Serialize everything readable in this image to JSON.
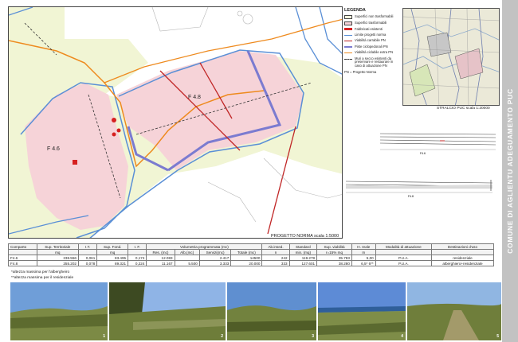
{
  "map": {
    "zone_labels": [
      "F 4.6",
      "F 4.8"
    ],
    "caption": "PROGETTO NORMA scala 1:5000"
  },
  "legend": {
    "title": "LEGENDA",
    "items": [
      {
        "label": "Superfici non trasformabili",
        "color": "#f4f6dc",
        "kind": "fill"
      },
      {
        "label": "Superfici trasformabili",
        "color": "#f6d3d8",
        "kind": "fill"
      },
      {
        "label": "Fabbricati esistenti",
        "color": "#d62020",
        "kind": "fill"
      },
      {
        "label": "Limite progetti norma",
        "color": "#5a8fd6",
        "kind": "line"
      },
      {
        "label": "Viabilità carrabile PN",
        "color": "#c02525",
        "kind": "line"
      },
      {
        "label": "Piste ciclopedonali PN",
        "color": "#7b7bd0",
        "kind": "line"
      },
      {
        "label": "Viabilità ciclabile extra PN",
        "color": "#ee8a1e",
        "kind": "line"
      },
      {
        "label": "Muri a secco esistenti da preservare e restaurare in caso di attuazione PN",
        "color": "#333333",
        "kind": "dash"
      },
      {
        "label": "PN = Progetto Norma",
        "color": "",
        "kind": "text"
      }
    ]
  },
  "inset": {
    "caption": "STRALCIO PUC scala 1:20000"
  },
  "sections": {
    "labels_top": [
      "F4.6"
    ],
    "labels_bottom": [
      "F4.8"
    ]
  },
  "table": {
    "header": [
      "Comparto",
      "Sup. Territoriale",
      "I.T.",
      "Sup. Fond.",
      "I. F.",
      "Volumetria programmata (mc)",
      "Ab.insed.",
      "Standard",
      "Sup. viabilità",
      "H. reale",
      "Modalità di attuazione",
      "Destinazioni d'uso"
    ],
    "subheader": [
      "",
      "mq",
      "",
      "mq",
      "",
      "Res. (mc)",
      "Alb.(mc)",
      "Servizi(mc)",
      "Totale (mc)",
      "n",
      "min. (mq)",
      "r=15% mq",
      "m",
      "",
      ""
    ],
    "rows": [
      [
        "F4.6",
        "238.556",
        "0,061",
        "83.495",
        "0,174",
        "12.083",
        "",
        "2.417",
        "14500",
        "242",
        "119.278",
        "35.783",
        "5,00",
        "P.U.A.",
        "residenziale"
      ],
      [
        "F4.8",
        "255.202",
        "0,078",
        "89.321",
        "0,224",
        "11.167",
        "5.500",
        "3.333",
        "20.000",
        "333",
        "127.601",
        "38.280",
        "6,5* 6**",
        "P.U.A.",
        "alberghiero+residenziale"
      ]
    ]
  },
  "notes": [
    "*altezza massima per l'albergheiro",
    "**altezza massima per il residenziale"
  ],
  "photos": [
    {
      "num": "1",
      "sky": "#6f9ed8",
      "ground": "#7c8a45"
    },
    {
      "num": "2",
      "sky": "#8fb4e6",
      "ground": "#6e7d3a"
    },
    {
      "num": "3",
      "sky": "#5f8fd0",
      "ground": "#72823e"
    },
    {
      "num": "4",
      "sky": "#5d8bd6",
      "ground": "#7e8d48"
    },
    {
      "num": "5",
      "sky": "#90b6e2",
      "ground": "#a39a6a"
    }
  ],
  "side_title": "COMUNE DI AGLIENTU ADEGUAMENTO PUC"
}
